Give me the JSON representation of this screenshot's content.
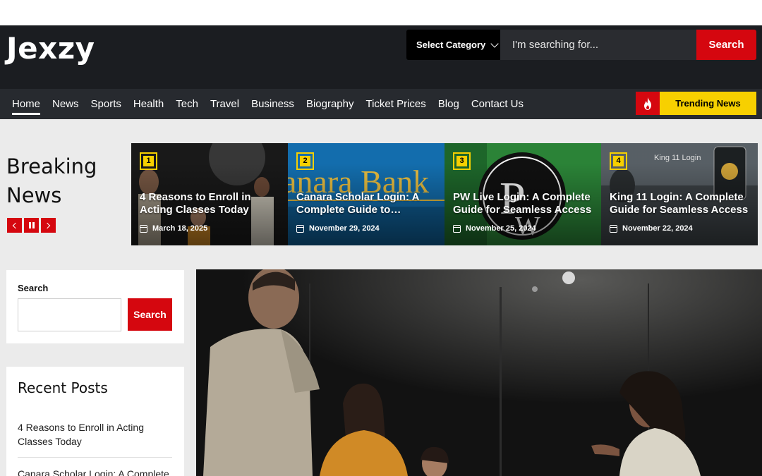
{
  "site": {
    "logo": "Jexzy"
  },
  "header": {
    "category_select": "Select Category",
    "search_placeholder": "I'm searching for...",
    "search_button": "Search"
  },
  "nav": {
    "items": [
      "Home",
      "News",
      "Sports",
      "Health",
      "Tech",
      "Travel",
      "Business",
      "Biography",
      "Ticket Prices",
      "Blog",
      "Contact Us"
    ],
    "active": "Home",
    "trending_label": "Trending News"
  },
  "breaking": {
    "title_line1": "Breaking",
    "title_line2": "News",
    "slides": [
      {
        "num": "1",
        "title": "4 Reasons to Enroll in Acting Classes Today",
        "date": "March 18, 2025",
        "theme": "dark-stage"
      },
      {
        "num": "2",
        "title": "Canara Scholar Login: A Complete Guide to…",
        "date": "November 29, 2024",
        "theme": "blue-bank"
      },
      {
        "num": "3",
        "title": "PW Live Login: A Complete Guide for Seamless Access",
        "date": "November 25, 2024",
        "theme": "green-pw"
      },
      {
        "num": "4",
        "title": "King 11 Login: A Complete Guide for Seamless Access",
        "date": "November 22, 2024",
        "theme": "gray-king"
      }
    ]
  },
  "sidebar": {
    "search_label": "Search",
    "search_button": "Search",
    "recent_title": "Recent Posts",
    "recent_posts": [
      "4 Reasons to Enroll in Acting Classes Today",
      "Canara Scholar Login: A Complete"
    ]
  },
  "colors": {
    "accent_red": "#d5070f",
    "accent_yellow": "#f7d000",
    "header_bg": "#1b1d21",
    "nav_bg": "#272a2f"
  }
}
